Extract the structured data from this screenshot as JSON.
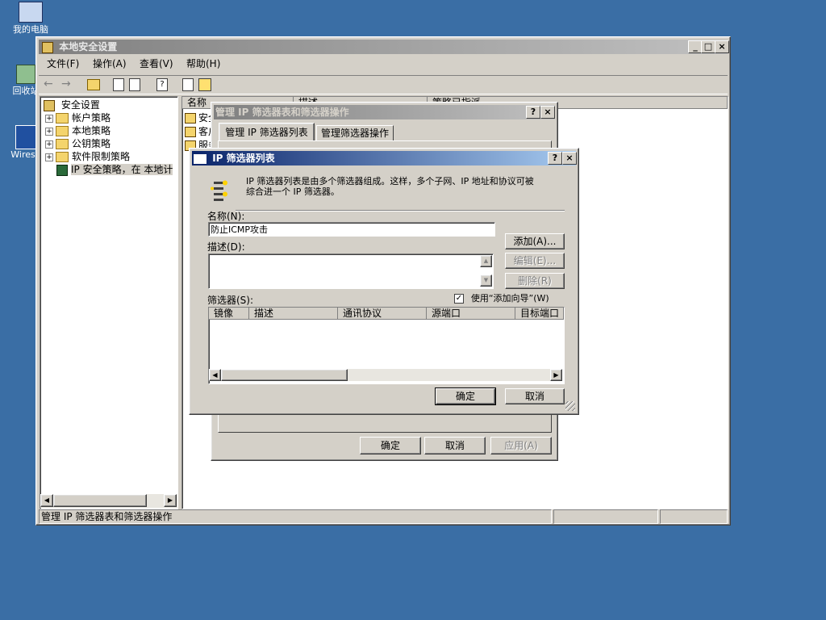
{
  "desktop": {
    "icons": [
      {
        "label": "我的电脑"
      },
      {
        "label": "回收站"
      },
      {
        "label": "Wiresh"
      }
    ]
  },
  "main_window": {
    "title": "本地安全设置",
    "menu": [
      "文件(F)",
      "操作(A)",
      "查看(V)",
      "帮助(H)"
    ],
    "tree": {
      "root": "安全设置",
      "items": [
        "帐户策略",
        "本地策略",
        "公钥策略",
        "软件限制策略",
        "IP 安全策略，在 本地计"
      ]
    },
    "list_headers": [
      "名称",
      "描述",
      "策略已指派"
    ],
    "list_items": [
      "安全",
      "客户",
      "服务"
    ],
    "status_bar": "管理 IP 筛选器表和筛选器操作"
  },
  "manage_dialog": {
    "title": "管理 IP 筛选器表和筛选器操作",
    "tabs": [
      "管理 IP 筛选器列表",
      "管理筛选器操作"
    ],
    "ok": "确定",
    "cancel": "取消",
    "apply": "应用(A)"
  },
  "filter_dialog": {
    "title": "IP 筛选器列表",
    "description_line1": "IP 筛选器列表是由多个筛选器组成。这样，多个子网、IP 地址和协议可被",
    "description_line2": "综合进一个 IP 筛选器。",
    "name_label": "名称(N):",
    "name_value": "防止ICMP攻击",
    "desc_label": "描述(D):",
    "desc_value": "",
    "add_button": "添加(A)...",
    "edit_button": "编辑(E)...",
    "delete_button": "删除(R)",
    "filters_label": "筛选器(S):",
    "wizard_checkbox": "使用“添加向导”(W)",
    "wizard_checked": true,
    "columns": [
      "镜像",
      "描述",
      "通讯协议",
      "源端口",
      "目标端口"
    ],
    "ok": "确定",
    "cancel": "取消"
  }
}
